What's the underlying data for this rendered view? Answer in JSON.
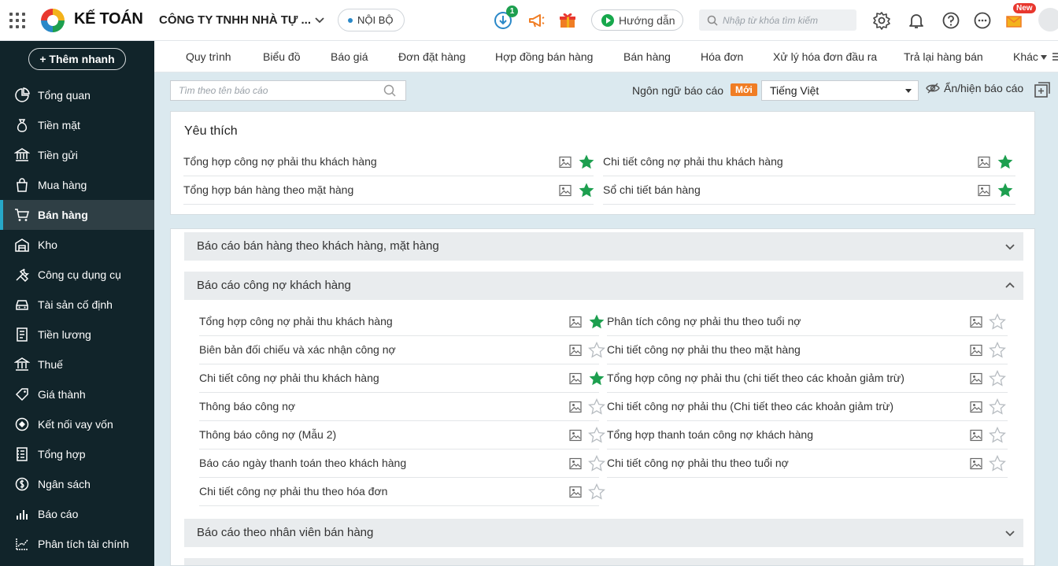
{
  "topbar": {
    "brand": "KẾ TOÁN",
    "company": "CÔNG TY TNHH NHÀ TỰ ...",
    "scope": "NỘI BỘ",
    "download_badge": "1",
    "help_label": "Hướng dẫn",
    "search_placeholder": "Nhập từ khóa tìm kiếm",
    "new_badge": "New"
  },
  "sidebar": {
    "quick_add": "+ Thêm nhanh",
    "items": [
      {
        "label": "Tổng quan",
        "icon": "pie-chart-icon"
      },
      {
        "label": "Tiền mặt",
        "icon": "money-bag-icon"
      },
      {
        "label": "Tiền gửi",
        "icon": "bank-icon"
      },
      {
        "label": "Mua hàng",
        "icon": "shopping-bag-icon"
      },
      {
        "label": "Bán hàng",
        "icon": "cart-icon",
        "active": true
      },
      {
        "label": "Kho",
        "icon": "warehouse-icon"
      },
      {
        "label": "Công cụ dụng cụ",
        "icon": "tools-icon"
      },
      {
        "label": "Tài sản cố định",
        "icon": "car-icon"
      },
      {
        "label": "Tiền lương",
        "icon": "payroll-icon"
      },
      {
        "label": "Thuế",
        "icon": "tax-icon"
      },
      {
        "label": "Giá thành",
        "icon": "price-tag-icon"
      },
      {
        "label": "Kết nối vay vốn",
        "icon": "loan-icon"
      },
      {
        "label": "Tổng hợp",
        "icon": "ledger-icon"
      },
      {
        "label": "Ngân sách",
        "icon": "budget-icon"
      },
      {
        "label": "Báo cáo",
        "icon": "bar-chart-icon"
      },
      {
        "label": "Phân tích tài chính",
        "icon": "analytics-icon"
      }
    ]
  },
  "tabs": [
    "Quy trình",
    "Biểu đồ",
    "Báo giá",
    "Đơn đặt hàng",
    "Hợp đồng bán hàng",
    "Bán hàng",
    "Hóa đơn",
    "Xử lý hóa đơn đầu ra",
    "Trả lại hàng bán",
    "Khác"
  ],
  "toolbar": {
    "search_placeholder": "Tìm theo tên báo cáo",
    "language_label": "Ngôn ngữ báo cáo",
    "new_tag": "Mới",
    "language_value": "Tiếng Việt",
    "hide_show": "Ẩn/hiện báo cáo"
  },
  "favorites": {
    "title": "Yêu thích",
    "left": [
      {
        "name": "Tổng hợp công nợ phải thu khách hàng",
        "starred": true
      },
      {
        "name": "Tổng hợp bán hàng theo mặt hàng",
        "starred": true
      }
    ],
    "right": [
      {
        "name": "Chi tiết công nợ phải thu khách hàng",
        "starred": true
      },
      {
        "name": "Sổ chi tiết bán hàng",
        "starred": true
      }
    ]
  },
  "groups": [
    {
      "title": "Báo cáo bán hàng theo khách hàng, mặt hàng",
      "expanded": false
    },
    {
      "title": "Báo cáo công nợ khách hàng",
      "expanded": true,
      "left": [
        {
          "name": "Tổng hợp công nợ phải thu khách hàng",
          "starred": true
        },
        {
          "name": "Biên bản đối chiếu và xác nhận công nợ",
          "starred": false
        },
        {
          "name": "Chi tiết công nợ phải thu khách hàng",
          "starred": true
        },
        {
          "name": "Thông báo công nợ",
          "starred": false
        },
        {
          "name": "Thông báo công nợ (Mẫu 2)",
          "starred": false
        },
        {
          "name": "Báo cáo ngày thanh toán theo khách hàng",
          "starred": false
        },
        {
          "name": "Chi tiết công nợ phải thu theo hóa đơn",
          "starred": false
        }
      ],
      "right": [
        {
          "name": "Phân tích công nợ phải thu theo tuổi nợ",
          "starred": false
        },
        {
          "name": "Chi tiết công nợ phải thu theo mặt hàng",
          "starred": false
        },
        {
          "name": "Tổng hợp công nợ phải thu (chi tiết theo các khoản giảm trừ)",
          "starred": false
        },
        {
          "name": "Chi tiết công nợ phải thu (Chi tiết theo các khoản giảm trừ)",
          "starred": false
        },
        {
          "name": "Tổng hợp thanh toán công nợ khách hàng",
          "starred": false
        },
        {
          "name": "Chi tiết công nợ phải thu theo tuổi nợ",
          "starred": false
        }
      ]
    },
    {
      "title": "Báo cáo theo nhân viên bán hàng",
      "expanded": false
    }
  ],
  "colors": {
    "sidebar_bg": "#11242a",
    "active_accent": "#27a7c8",
    "star_green": "#1d9f4f",
    "new_tag": "#f07d24",
    "page_bg": "#dbe9ef"
  }
}
